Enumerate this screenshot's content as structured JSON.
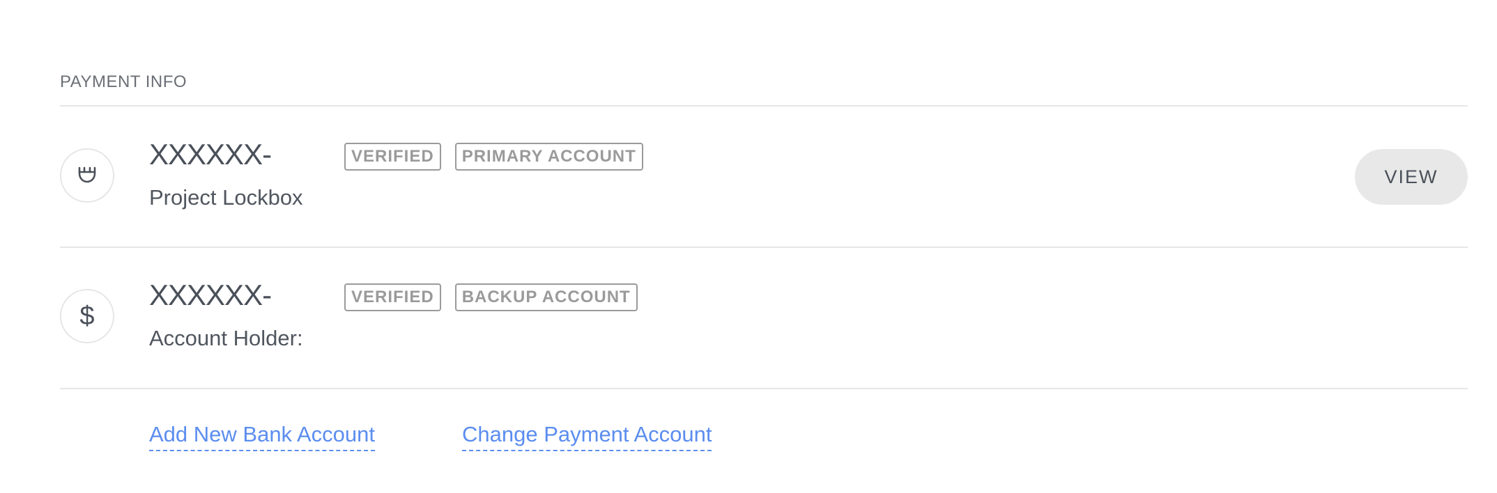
{
  "section": {
    "title": "PAYMENT INFO"
  },
  "accounts": [
    {
      "number": "XXXXXX-",
      "subtitle": "Project Lockbox",
      "icon": "lockbox-icon",
      "badges": [
        "VERIFIED",
        "PRIMARY ACCOUNT"
      ],
      "action_label": "VIEW"
    },
    {
      "number": "XXXXXX-",
      "subtitle": "Account Holder:",
      "icon": "dollar-icon",
      "badges": [
        "VERIFIED",
        "BACKUP ACCOUNT"
      ]
    }
  ],
  "links": {
    "add_bank": "Add New Bank Account",
    "change_payment": "Change Payment Account"
  },
  "colors": {
    "link": "#5b8def",
    "text": "#4a5059",
    "badge": "#9a9a9a",
    "divider": "#e6e6e6"
  }
}
